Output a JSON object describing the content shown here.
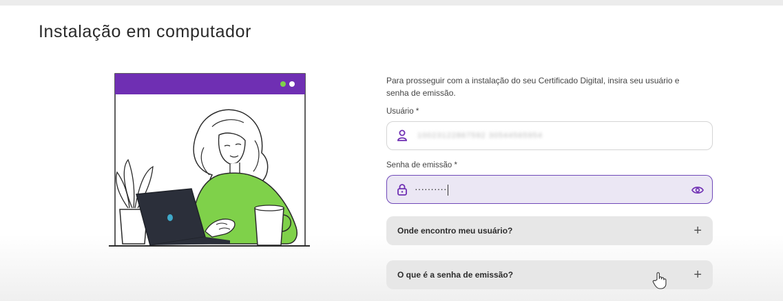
{
  "page": {
    "title": "Instalação em computador"
  },
  "form": {
    "intro": "Para prosseguir com a instalação do seu Certificado Digital, insira seu usuário e senha de emissão.",
    "user_label": "Usuário *",
    "user_value": "10023122867592 30544565954",
    "user_icon": "user-icon",
    "password_label": "Senha de emissão *",
    "password_value": "··········",
    "password_icon": "lock-icon",
    "toggle_icon": "eye-icon"
  },
  "faq": [
    {
      "label": "Onde encontro meu usuário?",
      "icon": "plus-icon"
    },
    {
      "label": "O que é a senha de emissão?",
      "icon": "plus-icon"
    }
  ],
  "colors": {
    "accent": "#6f2fb3",
    "focus_bg": "#ebe7f4",
    "sweater": "#7fd14a",
    "laptop": "#2b2f3a"
  }
}
